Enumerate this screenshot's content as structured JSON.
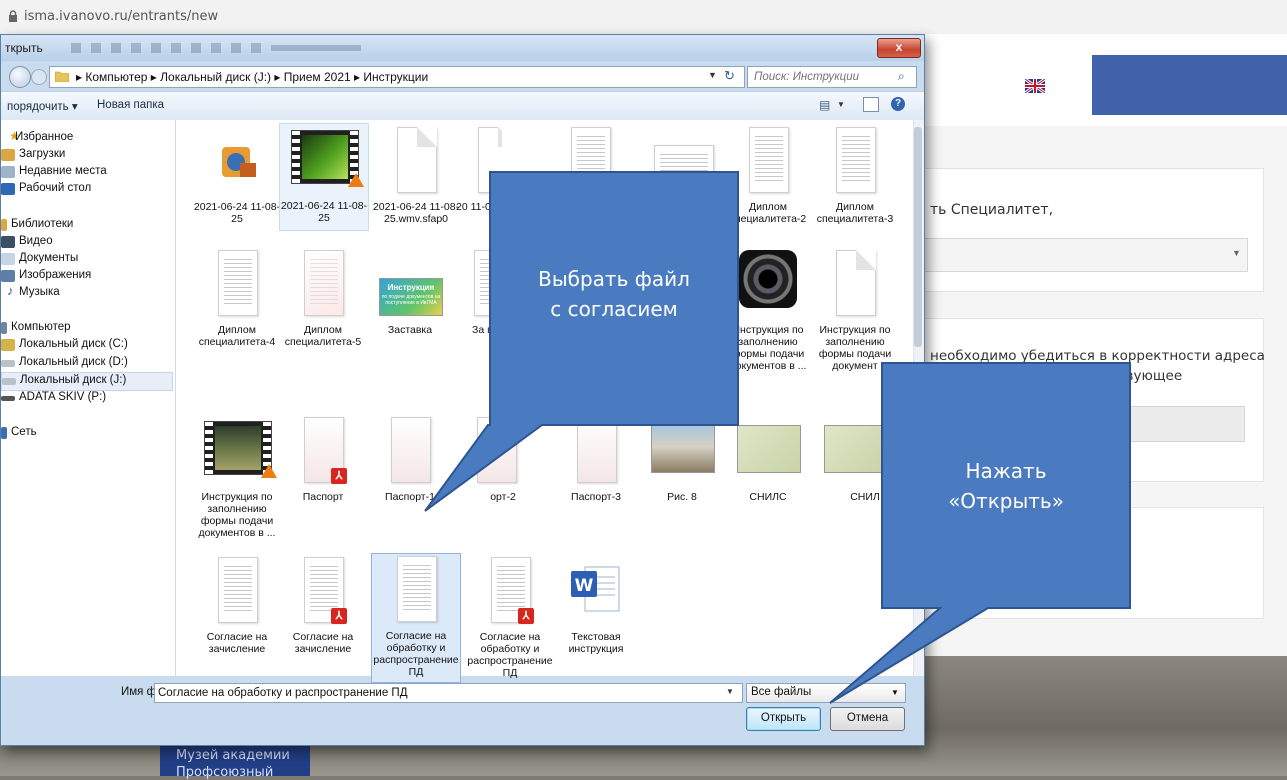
{
  "browser": {
    "url": "isma.ivanovo.ru/entrants/new"
  },
  "web": {
    "card1_text": "ть Специалитет,",
    "card2_line1": "необходимо убедиться в корректности адреса",
    "card2_line2": "ответствующее",
    "footer_links": [
      "Музей академии",
      "Профсоюзный"
    ]
  },
  "dialog": {
    "title": "ткрыть",
    "close_label": "x",
    "breadcrumbs": "▸ Компьютер ▸ Локальный диск (J:) ▸ Прием 2021 ▸ Инструкции",
    "search_placeholder": "Поиск: Инструкции",
    "organize_label": "порядочить ▾",
    "new_folder_label": "Новая папка",
    "help_label": "?",
    "nav": {
      "favorites": "Избранное",
      "downloads": "Загрузки",
      "recent": "Недавние места",
      "desktop": "Рабочий стол",
      "libraries": "Библиотеки",
      "video": "Видео",
      "documents": "Документы",
      "images": "Изображения",
      "music": "Музыка",
      "computer": "Компьютер",
      "disk_c": "Локальный диск (C:)",
      "disk_d": "Локальный диск (D:)",
      "disk_j": "Локальный диск (J:)",
      "adata": "ADATA SKIV (P:)",
      "network": "Сеть"
    },
    "files": [
      "2021-06-24 11-08-25",
      "2021-06-24 11-08-25",
      "2021-06-24 11-08-25.wmv.sfap0",
      "20 11-08",
      "Диплом специалитета-2",
      "Диплом специалитета-3",
      "Диплом специалитета-4",
      "Диплом специалитета-5",
      "Заставка",
      "За п",
      "Инструкция по заполнению формы подачи документов в ...",
      "Инструкция по заполнению формы подачи документ",
      "Инструкция по заполнению формы подачи документов в ...",
      "Паспорт",
      "Паспорт-1",
      "орт-2",
      "Паспорт-3",
      "Рис. 8",
      "СНИЛС",
      "СНИЛ",
      "Согласие на зачисление",
      "Согласие на зачисление",
      "Согласие на обработку и распространение ПД",
      "Согласие на обработку и распространение ПД",
      "Текстовая инструкция"
    ],
    "splash_label": "Инструкция",
    "splash_sub": "по подаче документов на поступление в ИвГМА",
    "filename_label": "Имя файла:",
    "filename_value": "Согласие на обработку и распространение ПД",
    "filter_value": "Все файлы",
    "open_label": "Открыть",
    "cancel_label": "Отмена"
  },
  "callouts": {
    "select_file": [
      "Выбрать файл",
      "с согласием"
    ],
    "press_open": [
      "Нажать",
      "«Открыть»"
    ]
  },
  "colors": {
    "callout_fill": "#4a7ac0",
    "callout_stroke": "#2f5590",
    "login_box": "#3f62aa",
    "selection": "#dce9f8"
  }
}
